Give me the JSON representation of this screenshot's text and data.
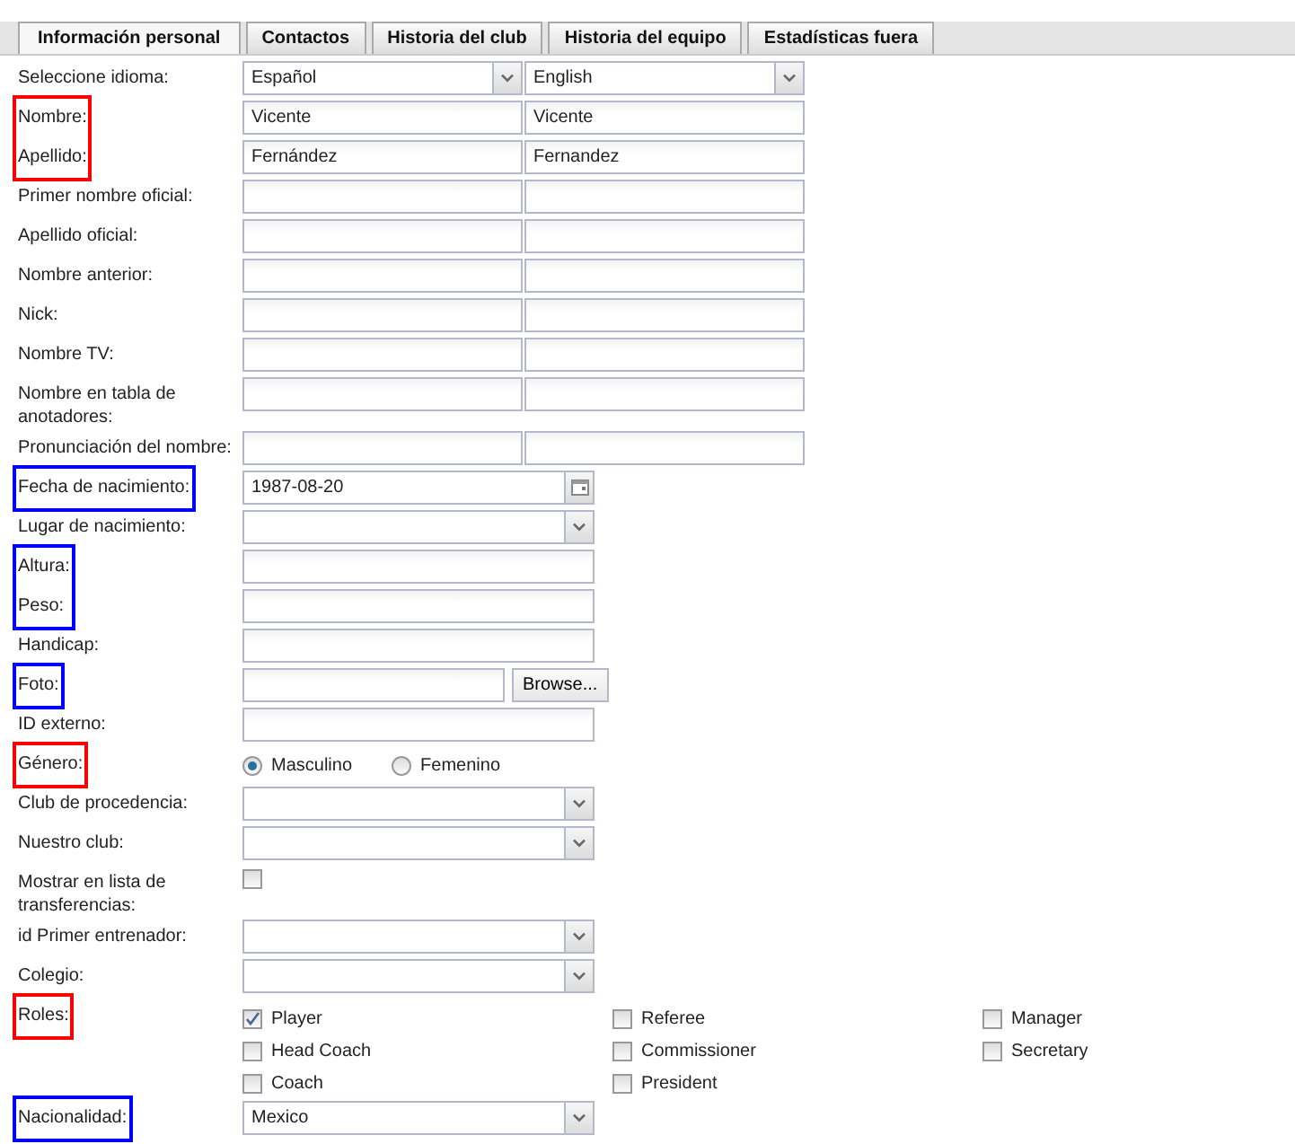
{
  "tabs": [
    {
      "label": "Información personal",
      "selected": true
    },
    {
      "label": "Contactos",
      "selected": false
    },
    {
      "label": "Historia del club",
      "selected": false
    },
    {
      "label": "Historia del equipo",
      "selected": false
    },
    {
      "label": "Estadísticas fuera",
      "selected": false
    }
  ],
  "rows": [
    {
      "kind": "select2",
      "label": "Seleccione idioma:",
      "values": [
        "Español",
        "English"
      ]
    },
    {
      "kind": "marked",
      "color": "#ff0000",
      "rows": [
        {
          "kind": "text2",
          "label": "Nombre:",
          "values": [
            "Vicente",
            "Vicente"
          ]
        },
        {
          "kind": "text2",
          "label": "Apellido:",
          "values": [
            "Fernández",
            "Fernandez"
          ]
        }
      ]
    },
    {
      "kind": "text2",
      "label": "Primer nombre oficial:"
    },
    {
      "kind": "text2",
      "label": "Apellido oficial:"
    },
    {
      "kind": "text2",
      "label": "Nombre anterior:"
    },
    {
      "kind": "text2",
      "label": "Nick:"
    },
    {
      "kind": "text2",
      "label": "Nombre TV:"
    },
    {
      "kind": "text2",
      "label": "Nombre en tabla de anotadores:"
    },
    {
      "kind": "text2",
      "label": "Pronunciación del nombre:"
    },
    {
      "kind": "marked",
      "color": "#0000ff",
      "rows": [
        {
          "kind": "date",
          "label": "Fecha de nacimiento:",
          "value": "1987-08-20"
        }
      ]
    },
    {
      "kind": "select",
      "label": "Lugar de nacimiento:"
    },
    {
      "kind": "marked",
      "color": "#0000ff",
      "rows": [
        {
          "kind": "text",
          "label": "Altura:"
        },
        {
          "kind": "text",
          "label": "Peso:"
        }
      ]
    },
    {
      "kind": "text",
      "label": "Handicap:"
    },
    {
      "kind": "marked",
      "color": "#0000ff",
      "rows": [
        {
          "kind": "file",
          "label": "Foto:",
          "button": "Browse..."
        }
      ]
    },
    {
      "kind": "text",
      "label": "ID externo:"
    },
    {
      "kind": "marked",
      "color": "#ff0000",
      "rows": [
        {
          "kind": "radio",
          "label": "Género:",
          "options": [
            {
              "label": "Masculino",
              "selected": true
            },
            {
              "label": "Femenino",
              "selected": false
            }
          ]
        }
      ]
    },
    {
      "kind": "select",
      "label": "Club de procedencia:"
    },
    {
      "kind": "select",
      "label": "Nuestro club:"
    },
    {
      "kind": "checkbox",
      "label": "Mostrar en lista de transferencias:",
      "checked": false
    },
    {
      "kind": "select",
      "label": "id Primer entrenador:"
    },
    {
      "kind": "select",
      "label": "Colegio:"
    },
    {
      "kind": "marked",
      "color": "#ff0000",
      "rows": [
        {
          "kind": "checkgroup",
          "label": "Roles:",
          "columns": [
            [
              {
                "label": "Player",
                "checked": true
              },
              {
                "label": "Head Coach",
                "checked": false
              },
              {
                "label": "Coach",
                "checked": false
              }
            ],
            [
              {
                "label": "Referee",
                "checked": false
              },
              {
                "label": "Commissioner",
                "checked": false
              },
              {
                "label": "President",
                "checked": false
              }
            ],
            [
              {
                "label": "Manager",
                "checked": false
              },
              {
                "label": "Secretary",
                "checked": false
              }
            ]
          ]
        }
      ]
    },
    {
      "kind": "marked",
      "color": "#0000ff",
      "rows": [
        {
          "kind": "select",
          "label": "Nacionalidad:",
          "value": "Mexico"
        }
      ]
    }
  ]
}
